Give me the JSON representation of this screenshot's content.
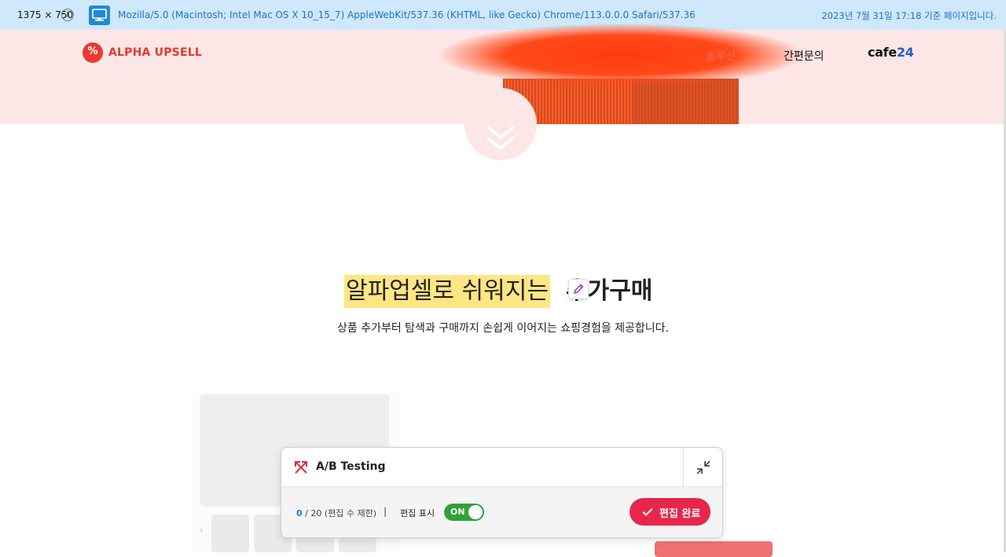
{
  "infobar": {
    "dimensions": "1375 × 750",
    "info_glyph": "i",
    "user_agent": "Mozilla/5.0 (Macintosh; Intel Mac OS X 10_15_7) AppleWebKit/537.36 (KHTML, like Gecko) Chrome/113.0.0.0 Safari/537.36",
    "capture_date": "2023년 7월 31일 17:18 기준 페이지입니다."
  },
  "header": {
    "logo_mark": "%",
    "logo_text": "ALPHA UPSELL",
    "nav": {
      "solution": "솔루션",
      "inquiry": "간편문의",
      "cafe_prefix": "cafe",
      "cafe_suffix": "24"
    }
  },
  "hero": {
    "headline_highlighted": "알파업셀로 쉬워지는 ",
    "headline_rest": "추가구매",
    "subline": "상품 추가부터 탐색과 구매까지 손쉽게 이어지는 쇼핑경험을 제공합니다."
  },
  "ab_panel": {
    "title": "A/B Testing",
    "count_current": "0",
    "count_rest": " / 20 (편집 수 제한)",
    "separator": "|",
    "show_label": "편집 표시",
    "toggle_label": "ON",
    "done_label": "편집 완료"
  },
  "colors": {
    "brand_red": "#e23a2c",
    "done_button": "#e8264b",
    "toggle_on": "#31a13a",
    "header_bg": "#fde6e6",
    "highlight": "#ffe683"
  },
  "icons": [
    "info-icon",
    "monitor-icon",
    "logo-badge-icon",
    "double-chevron-down-icon",
    "pencil-icon",
    "ab-testing-icon",
    "collapse-icon",
    "check-icon"
  ]
}
